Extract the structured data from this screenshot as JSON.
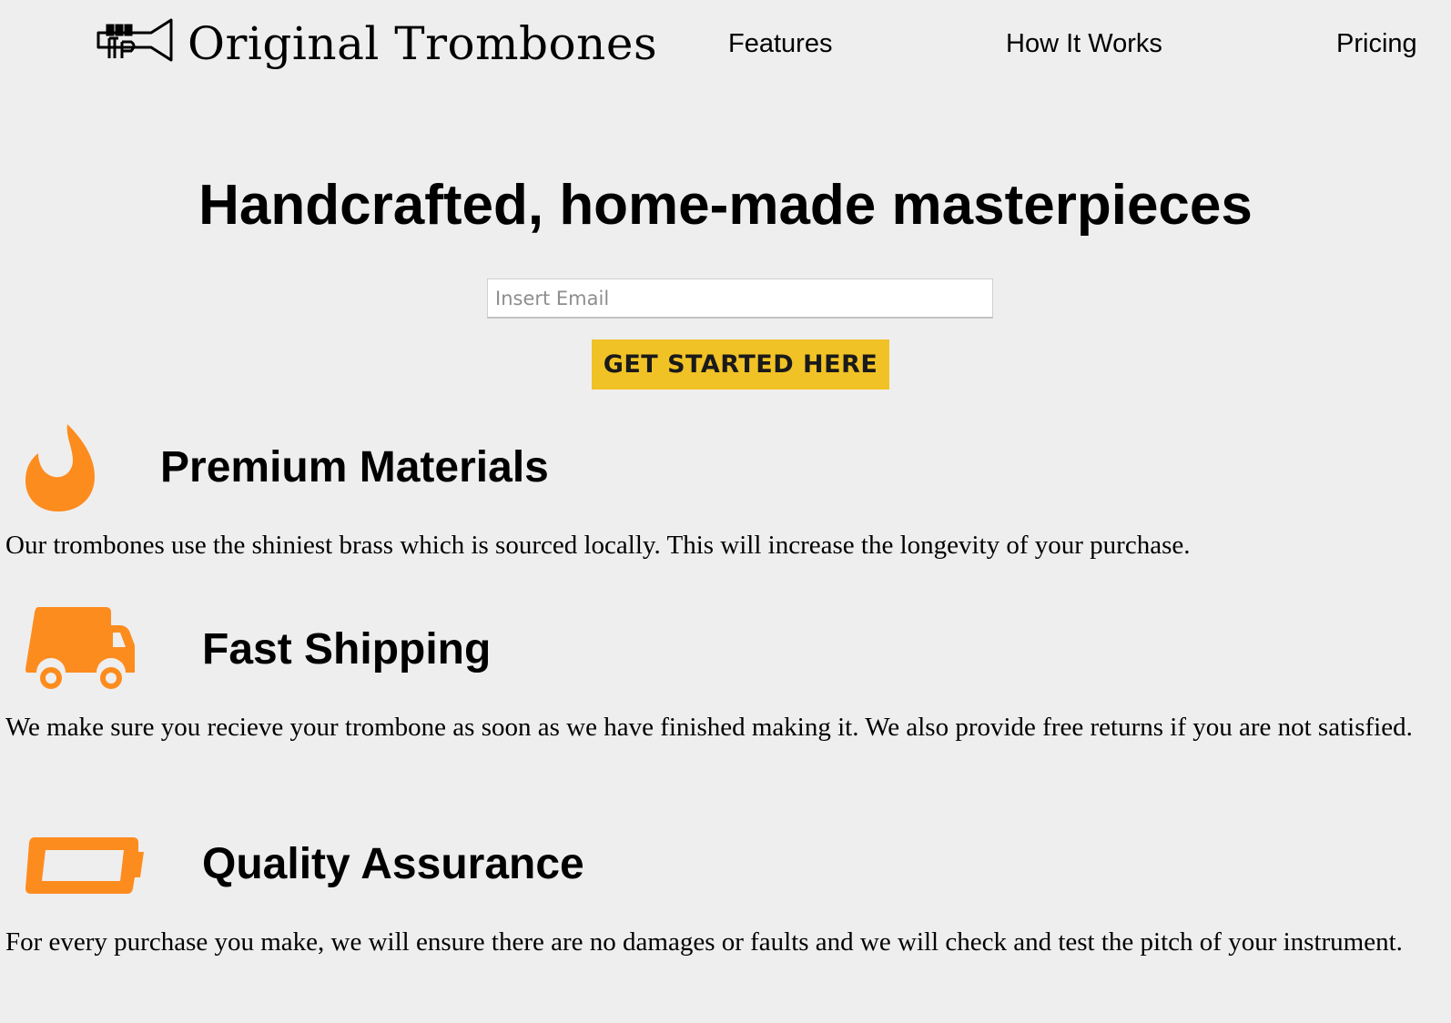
{
  "brand": {
    "name": "Original Trombones",
    "logo_icon": "trumpet-logo-icon"
  },
  "nav": {
    "features": "Features",
    "how_it_works": "How It Works",
    "pricing": "Pricing"
  },
  "hero": {
    "title": "Handcrafted, home-made masterpieces",
    "email_placeholder": "Insert Email",
    "email_value": "",
    "cta_label": "GET STARTED HERE"
  },
  "features": [
    {
      "icon": "fire-icon",
      "title": "Premium Materials",
      "description": "Our trombones use the shiniest brass which is sourced locally. This will increase the longevity of your purchase."
    },
    {
      "icon": "truck-icon",
      "title": "Fast Shipping",
      "description": "We make sure you recieve your trombone as soon as we have finished making it. We also provide free returns if you are not satisfied."
    },
    {
      "icon": "battery-icon",
      "title": "Quality Assurance",
      "description": "For every purchase you make, we will ensure there are no damages or faults and we will check and test the pitch of your instrument."
    }
  ],
  "colors": {
    "accent": "#f1c226",
    "icon": "#fd8c1e",
    "background": "#eeeeee"
  }
}
